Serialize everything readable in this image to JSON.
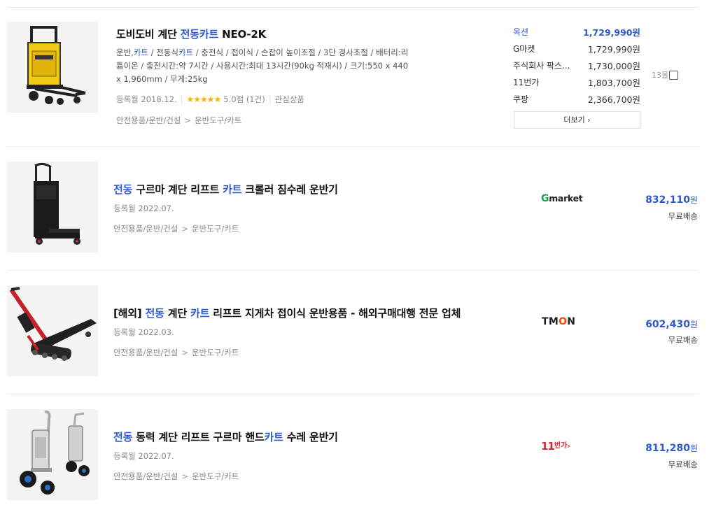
{
  "products": [
    {
      "title_parts": [
        {
          "text": "도비도비 계단 ",
          "hl": false
        },
        {
          "text": "전동카트",
          "hl": true
        },
        {
          "text": " NEO-2K",
          "hl": false
        }
      ],
      "spec_parts": [
        {
          "text": "운반,",
          "hl": false
        },
        {
          "text": "카트",
          "hl": true
        },
        {
          "text": " / 전동식",
          "hl": false
        },
        {
          "text": "카트",
          "hl": true
        },
        {
          "text": " / 충전식 / 접이식 / 손잡이 높이조절 / 3단 경사조절 / 배터리:리튬이온 / 충전시간:약 7시간 / 사용시간:최대 13시간(90kg 적재시) / 크기:550 x 440 x 1,960mm / 무게:25kg",
          "hl": false
        }
      ],
      "registered": "등록월 2018.12.",
      "stars": "★★★★★",
      "rating": "5.0점",
      "review_count": "(1건)",
      "wishlist": "관심상품",
      "category": [
        "안전용품/운반/건설",
        "운반도구/카트"
      ],
      "category_sep": ">",
      "malls": [
        {
          "name": "옥션",
          "price": "1,729,990원"
        },
        {
          "name": "G마켓",
          "price": "1,729,990원"
        },
        {
          "name": "주식회사 팍스...",
          "price": "1,730,000원"
        },
        {
          "name": "11번가",
          "price": "1,803,700원"
        },
        {
          "name": "쿠팡",
          "price": "2,366,700원"
        }
      ],
      "more_label": "더보기 ›",
      "mall_count": "13몰"
    },
    {
      "title_parts": [
        {
          "text": "전동",
          "hl": true
        },
        {
          "text": " 구르마 계단 리프트 ",
          "hl": false
        },
        {
          "text": "카트",
          "hl": true
        },
        {
          "text": " 크롤러 짐수레 운반기",
          "hl": false
        }
      ],
      "registered": "등록월 2022.07.",
      "category": [
        "안전용품/운반/건설",
        "운반도구/카트"
      ],
      "category_sep": ">",
      "mall_logo": {
        "g": "G",
        "rest": "market",
        "g_color": "#16a34a",
        "color": "#222222"
      },
      "price": "832,110",
      "won": "원",
      "shipping": "무료배송"
    },
    {
      "title_parts": [
        {
          "text": "[해외] ",
          "hl": false
        },
        {
          "text": "전동",
          "hl": true
        },
        {
          "text": " 계단 ",
          "hl": false
        },
        {
          "text": "카트",
          "hl": true
        },
        {
          "text": " 리프트 지게차 접이식 운반용품 - 해외구매대행 전문 업체",
          "hl": false
        }
      ],
      "registered": "등록월 2022.03.",
      "category": [
        "안전용품/운반/건설",
        "운반도구/카트"
      ],
      "category_sep": ">",
      "mall_logo": {
        "pre": "TM",
        "o": "O",
        "post": "N",
        "color": "#222222",
        "o_color": "#ff4800"
      },
      "price": "602,430",
      "won": "원",
      "shipping": "무료배송"
    },
    {
      "title_parts": [
        {
          "text": "전동",
          "hl": true
        },
        {
          "text": " 동력 계단 리프트 구르마 핸드",
          "hl": false
        },
        {
          "text": "카트",
          "hl": true
        },
        {
          "text": " 수레 운반기",
          "hl": false
        }
      ],
      "registered": "등록월 2022.07.",
      "category": [
        "안전용품/운반/건설",
        "운반도구/카트"
      ],
      "category_sep": ">",
      "mall_logo": {
        "num": "11",
        "text": "번가",
        "color": "#e5202e"
      },
      "price": "811,280",
      "won": "원",
      "shipping": "무료배송"
    }
  ],
  "icons": {
    "star": "star-icon",
    "checkbox": "checkbox-icon",
    "chevron": "chevron-right-icon"
  }
}
